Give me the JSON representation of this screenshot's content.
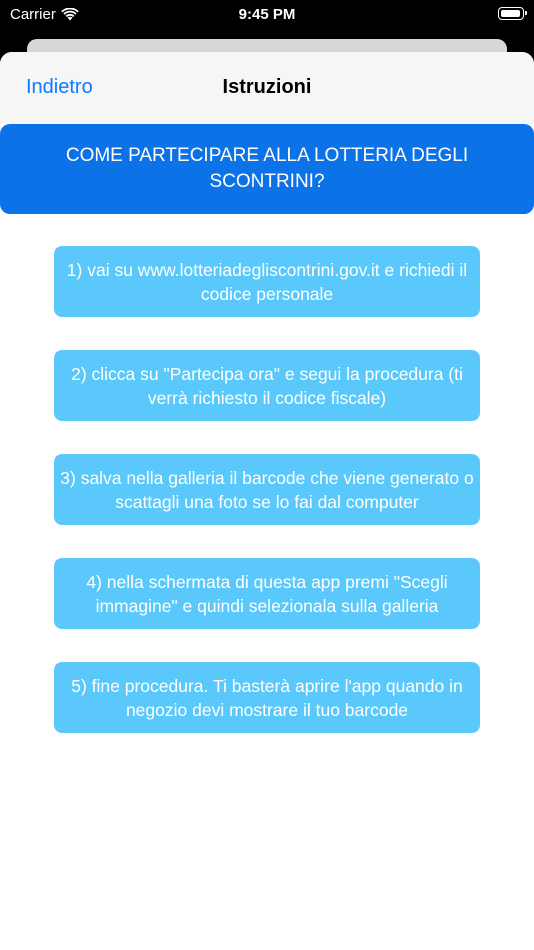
{
  "status_bar": {
    "carrier": "Carrier",
    "time": "9:45 PM"
  },
  "nav": {
    "back_label": "Indietro",
    "title": "Istruzioni"
  },
  "banner": {
    "text": "COME PARTECIPARE ALLA LOTTERIA DEGLI SCONTRINI?"
  },
  "steps": [
    "1) vai su www.lotteriadegliscontrini.gov.it e richiedi il codice personale",
    "2) clicca su \"Partecipa ora\" e segui la procedura (ti verrà richiesto il codice fiscale)",
    "3) salva nella galleria il barcode che viene generato o scattagli una foto se lo fai dal computer",
    "4) nella schermata di questa app premi \"Scegli immagine\" e quindi selezionala sulla galleria",
    "5) fine procedura. Ti basterà aprire l'app quando in negozio devi mostrare il tuo barcode"
  ],
  "colors": {
    "accent": "#0a7aff",
    "banner": "#0b72e7",
    "step": "#5ac8fa"
  },
  "icons": [
    "wifi-icon",
    "battery-icon"
  ]
}
